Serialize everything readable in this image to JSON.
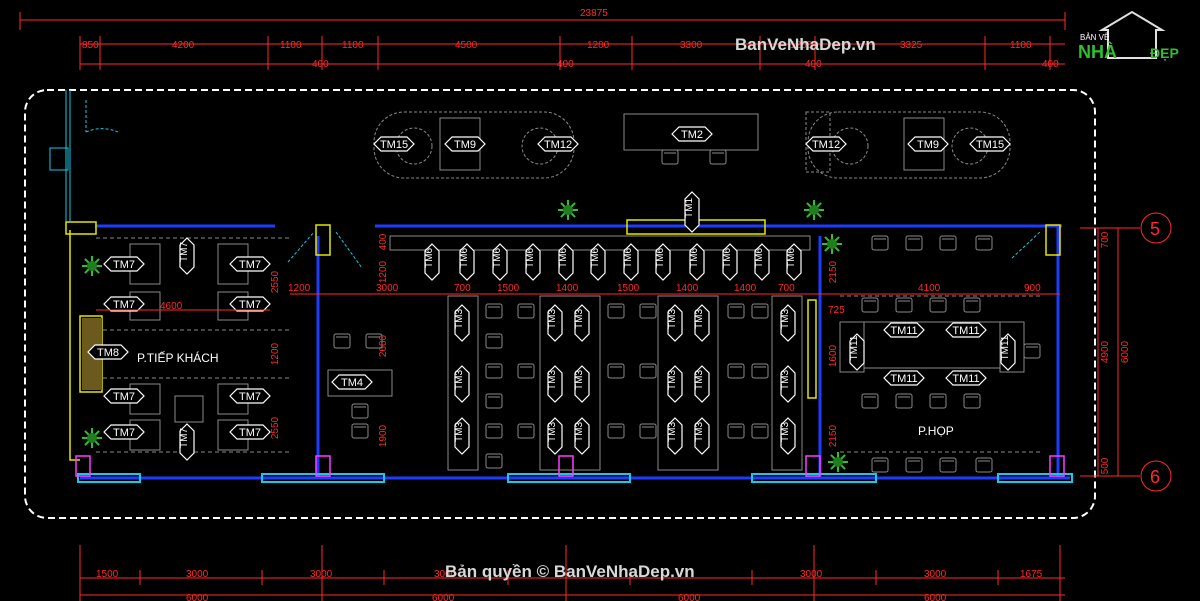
{
  "watermark_top": "BanVeNhaDep.vn",
  "watermark_bottom": "Bản quyền © BanVeNhaDep.vn",
  "logo": {
    "line1": "BẢN VẼ",
    "line2": "NHÀ",
    "line3": "ĐẸP"
  },
  "rooms": {
    "reception": "P.TIẾP KHÁCH",
    "meeting": "P.HỌP"
  },
  "axis_labels": [
    "5",
    "6"
  ],
  "overall_dim": "23875",
  "top_dims": [
    "850",
    "4200",
    "1100",
    "1100",
    "4500",
    "1200",
    "3300",
    "1200",
    "3325",
    "1100"
  ],
  "top_small_dims": [
    "400",
    "400",
    "400",
    "400",
    "400"
  ],
  "bottom_dims": [
    "1500",
    "3000",
    "3000",
    "3000",
    "3000",
    "3000",
    "1675"
  ],
  "bottom_dims2": [
    "6000",
    "6000",
    "6000",
    "6000"
  ],
  "mid_dims": [
    "1200",
    "3000",
    "700",
    "1500",
    "1400",
    "1500",
    "1400",
    "1400",
    "700",
    "4100",
    "900",
    "725"
  ],
  "left_dims": [
    "4600"
  ],
  "vertical_dims": [
    "2550",
    "1200",
    "2550",
    "400",
    "1200",
    "2600",
    "1900",
    "2150",
    "1600",
    "2150",
    "700",
    "4900",
    "6000",
    "500"
  ],
  "tags": {
    "tm1": "TM1",
    "tm2": "TM2",
    "tm3": "TM3",
    "tm4": "TM4",
    "tm6": "TM6",
    "tm7": "TM7",
    "tm8": "TM8",
    "tm9": "TM9",
    "tm11": "TM11",
    "tm12": "TM12",
    "tm15": "TM15"
  },
  "colors": {
    "background": "#000000",
    "wall_blue": "#1e3cff",
    "dimension_red": "#ff2a2a",
    "glass_cyan": "#19c8e6",
    "yellow_line": "#e6e600",
    "grey_furniture": "#8a8a8a",
    "plant_green": "#2fbf2f",
    "magenta_column": "#ff3cff"
  }
}
